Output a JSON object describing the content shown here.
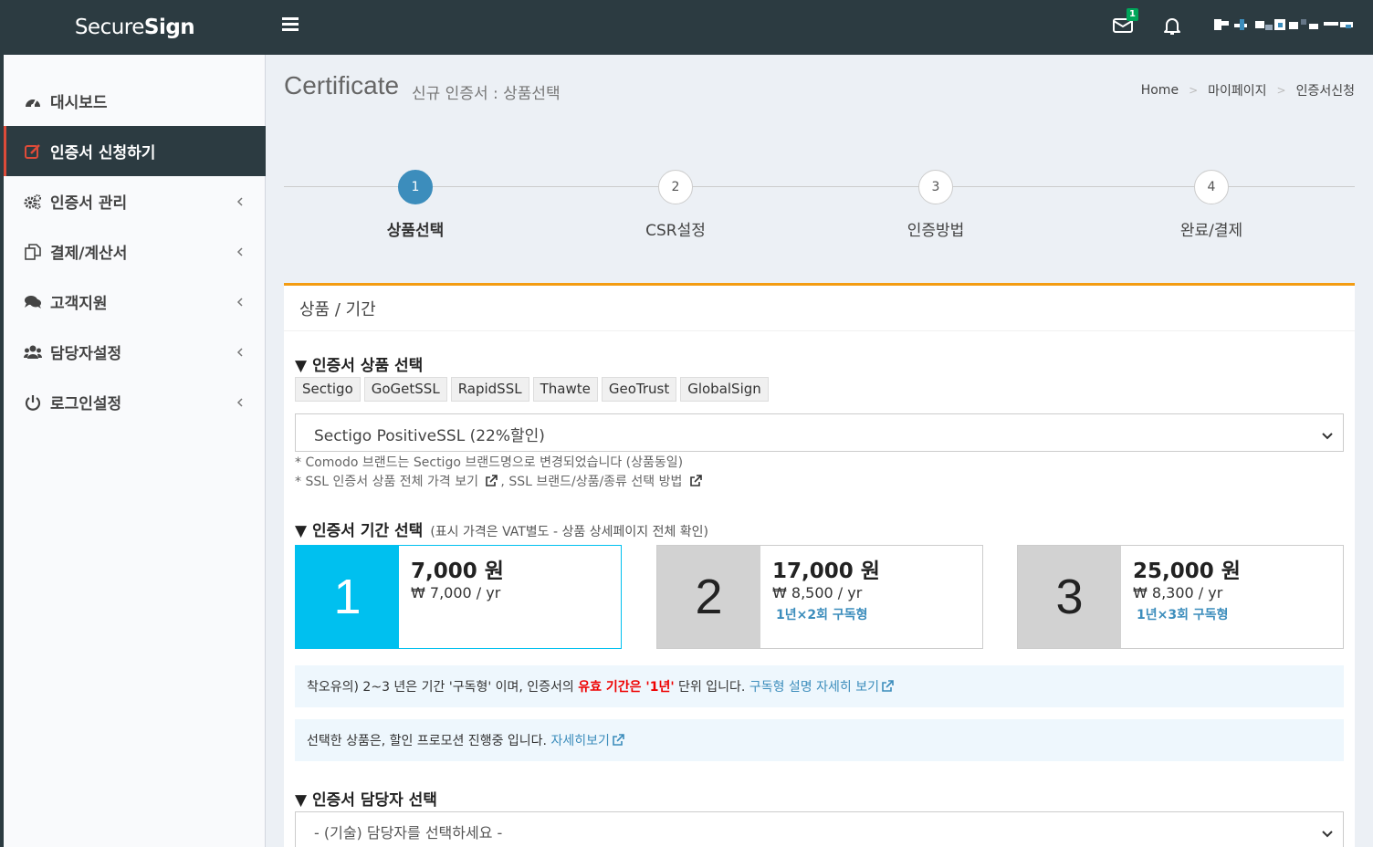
{
  "header": {
    "logo_light": "Secure",
    "logo_bold": "Sign",
    "mail_badge": "1"
  },
  "sidebar": {
    "items": [
      {
        "label": "대시보드",
        "icon": "dashboard-icon"
      },
      {
        "label": "인증서 신청하기",
        "icon": "edit-icon",
        "active": true
      },
      {
        "label": "인증서 관리",
        "icon": "gears-icon"
      },
      {
        "label": "결제/계산서",
        "icon": "copy-icon"
      },
      {
        "label": "고객지원",
        "icon": "comments-icon"
      },
      {
        "label": "담당자설정",
        "icon": "users-icon"
      },
      {
        "label": "로그인설정",
        "icon": "power-icon"
      }
    ]
  },
  "page": {
    "title": "Certificate",
    "subtitle": "신규 인증서 : 상품선택",
    "breadcrumb": [
      "Home",
      "마이페이지",
      "인증서신청"
    ]
  },
  "steps": [
    {
      "num": "1",
      "label": "상품선택",
      "active": true
    },
    {
      "num": "2",
      "label": "CSR설정"
    },
    {
      "num": "3",
      "label": "인증방법"
    },
    {
      "num": "4",
      "label": "완료/결제"
    }
  ],
  "box": {
    "header": "상품 / 기간",
    "product_section": "▼ 인증서 상품 선택",
    "brands": [
      "Sectigo",
      "GoGetSSL",
      "RapidSSL",
      "Thawte",
      "GeoTrust",
      "GlobalSign"
    ],
    "product_selected": "Sectigo PositiveSSL (22%할인)",
    "note1": "* Comodo 브랜드는 Sectigo 브랜드명으로 변경되었습니다 (상품동일)",
    "note2a": "* SSL 인증서 상품 전체 가격 보기",
    "note2b": ", SSL 브랜드/상품/종류 선택 방법",
    "period_section": "▼ 인증서 기간 선택",
    "period_note": "(표시 가격은 VAT별도 - 상품 상세페이지 전체 확인)",
    "periods": [
      {
        "num": "1",
        "price": "7,000 원",
        "rate": "₩ 7,000 / yr",
        "sub": ""
      },
      {
        "num": "2",
        "price": "17,000 원",
        "rate": "₩ 8,500 / yr",
        "sub": "1년×2회 구독형"
      },
      {
        "num": "3",
        "price": "25,000 원",
        "rate": "₩ 8,300 / yr",
        "sub": "1년×3회 구독형"
      }
    ],
    "info1_prefix": "착오유의) 2~3 년은 기간 '구독형' 이며, 인증서의 ",
    "info1_red": "유효 기간은 '1년'",
    "info1_suffix": " 단위 입니다. ",
    "info1_link": "구독형 설명 자세히 보기",
    "info2_text": "선택한 상품은, 할인 프로모션 진행중 입니다. ",
    "info2_link": "자세히보기",
    "contact_section": "▼ 인증서 담당자 선택",
    "contact_placeholder": "- (기술) 담당자를 선택하세요 -"
  },
  "colors": {
    "topbar": "#2c3b41",
    "active_step": "#3c8dbc",
    "selected_period": "#00c0ef",
    "box_border": "#f39c12",
    "warning_red": "#e00000"
  }
}
